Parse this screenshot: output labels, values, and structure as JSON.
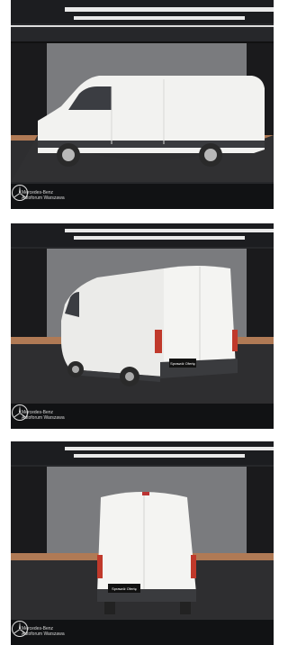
{
  "gallery": {
    "photos": [
      {
        "view": "side",
        "dealer_line1": "Mercedes-Benz",
        "dealer_line2": "Autoforum Warszawa",
        "logo": "mercedes-star-icon"
      },
      {
        "view": "rear-three-quarter",
        "dealer_line1": "Mercedes-Benz",
        "dealer_line2": "Autoforum Warszawa",
        "logo": "mercedes-star-icon",
        "plate_text": "Sprawdź Ofertę"
      },
      {
        "view": "rear",
        "dealer_line1": "Mercedes-Benz",
        "dealer_line2": "Autoforum Warszawa",
        "logo": "mercedes-star-icon",
        "plate_text": "Sprawdź Ofertę"
      }
    ]
  },
  "colors": {
    "footer": "#111214",
    "van": "#f2f2f0",
    "wall": "#7a7b7e",
    "floor": "#2e2e30"
  }
}
